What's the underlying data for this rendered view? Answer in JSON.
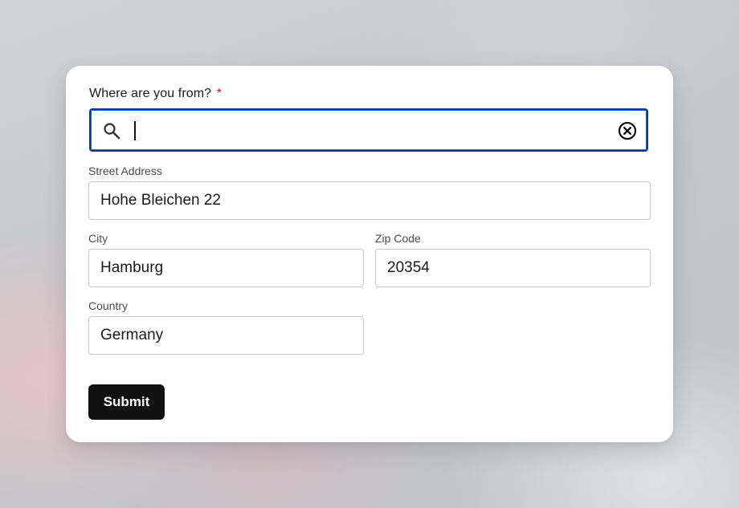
{
  "form": {
    "question_label": "Where are you from?",
    "required_marker": "*",
    "search": {
      "value": "",
      "placeholder": "",
      "icon": "search-icon",
      "clear_icon": "clear-circle-x-icon"
    },
    "street_address": {
      "label": "Street Address",
      "value": "Hohe Bleichen 22"
    },
    "city": {
      "label": "City",
      "value": "Hamburg"
    },
    "zip_code": {
      "label": "Zip Code",
      "value": "20354"
    },
    "country": {
      "label": "Country",
      "value": "Germany"
    },
    "submit_label": "Submit"
  },
  "colors": {
    "focus_border": "#0f3a8c",
    "required": "#c8102e",
    "button_bg": "#111111"
  }
}
